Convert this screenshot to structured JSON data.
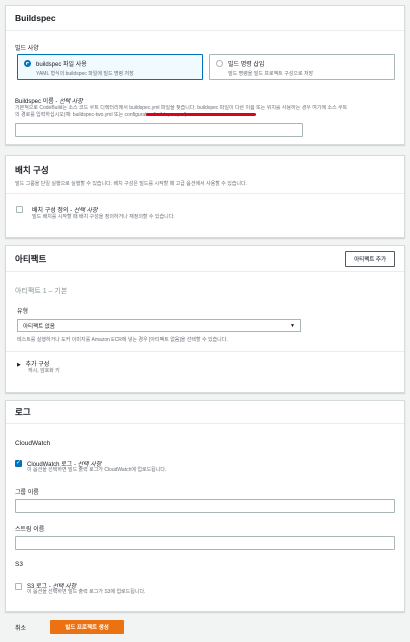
{
  "buildspec": {
    "title": "Buildspec",
    "spec_label": "빌드 사양",
    "option_file": {
      "title": "buildspec 파일 사용",
      "desc": "YAML 형식의 buildspec 파일에 빌드 명령 저장"
    },
    "option_insert": {
      "title": "빌드 명령 삽입",
      "desc": "빌드 명령을 빌드 프로젝트 구성으로 저장"
    },
    "name_label": "Buildspec 이름",
    "name_optional": " - 선택 사항",
    "name_desc_1": "기본적으로 CodeBuild는 소스 코드 루트 디렉터리에서 buildspec.yml 파일을 찾습니다. buildspec 파일이 다른 이름 또는 위치를 사용하는 경우 여기에 소스 루트",
    "name_desc_2": "의 경로를 입력하십시오(예: buildspec-two.yml 또는 configuration/buildspec.yml).",
    "name_value": ""
  },
  "batch": {
    "title": "배치 구성",
    "desc": "빌드 그룹을 단일 실행으로 실행할 수 있습니다. 배치 구성은 빌드를 시작할 때 고급 옵션에서 사용할 수 있습니다.",
    "checkbox_label": "배치 구성 정의",
    "checkbox_optional": " - 선택 사항",
    "checkbox_desc": "빌드 배치를 시작할 때 배치 구성을 정의하거나 재정의할 수 있습니다."
  },
  "artifacts": {
    "title": "아티팩트",
    "add_button": "아티팩트 추가",
    "subtitle": "아티팩트 1 – 기본",
    "type_label": "유형",
    "type_selected": "아티팩트 없음",
    "type_desc": "테스트를 실행하거나 도커 이미지를 Amazon ECR에 넣는 경우 [아티팩트 없음]을 선택할 수 있습니다.",
    "additional_title": "추가 구성",
    "additional_desc": "캐시, 암호화 키"
  },
  "logs": {
    "title": "로그",
    "cloudwatch_heading": "CloudWatch",
    "cloudwatch_label": "CloudWatch 로그",
    "cloudwatch_optional": " - 선택 사항",
    "cloudwatch_desc": "이 옵션을 선택하면 빌드 출력 로그가 CloudWatch에 업로드됩니다.",
    "group_label": "그룹 이름",
    "stream_label": "스트림 이름",
    "s3_heading": "S3",
    "s3_label": "S3 로그",
    "s3_optional": " - 선택 사항",
    "s3_desc": "이 옵션을 선택하면 빌드 출력 로그가 S3에 업로드됩니다."
  },
  "footer": {
    "cancel": "취소",
    "create": "빌드 프로젝트 생성"
  },
  "colors": {
    "primary": "#ec7211",
    "selected_border": "#0073bb",
    "annotation_red": "#e0001b"
  }
}
